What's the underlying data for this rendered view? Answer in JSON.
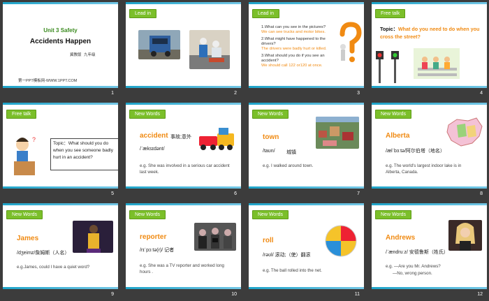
{
  "slides": [
    {
      "num": "1",
      "title_line1": "Unit 3 Safety",
      "title_line2": "Accidents Happen",
      "sub1": "冀教版",
      "sub2": "九年级",
      "footer": "第一PPT模板网-WWW.1PPT.COM"
    },
    {
      "num": "2",
      "tag": "Lead in"
    },
    {
      "num": "3",
      "tag": "Lead in",
      "q1": "1.What can you see in the pictures?",
      "a1": "We can see trucks and motor bikes.",
      "q2": "2.What might have happened to the drivers?",
      "a2": "The drivers were badly hurt or killed.",
      "q3": "3.What should you do if you see an accident?",
      "a3": "We should call 122 or120 at once."
    },
    {
      "num": "4",
      "tag": "Free talk",
      "topic_label": "Topic：",
      "topic": "What do you need to do when you cross the street?"
    },
    {
      "num": "5",
      "tag": "Free talk",
      "topic_label": "Topic：",
      "topic": "What should you do when you see someone badly hurt in an accident?"
    },
    {
      "num": "6",
      "tag": "New Words",
      "word": "accident",
      "meaning": "事故;意外",
      "phon": "/ˈæksɪdənt/",
      "eg": "e.g. She was involved in a serious car accident last week."
    },
    {
      "num": "7",
      "tag": "New Words",
      "word": "town",
      "phon": "/taʊn/",
      "meaning": "城镇",
      "eg": "e.g. I walked around town."
    },
    {
      "num": "8",
      "tag": "New Words",
      "word": "Alberta",
      "phon": "/ælˈbɜːtə/阿尔伯塔（地名）",
      "eg": "e.g. The world's largest indoor lake is in Alberta, Canada."
    },
    {
      "num": "9",
      "tag": "New Words",
      "word": "James",
      "phon": "/dʒeimz/詹姆斯（人名）",
      "eg": "e.g.James, could I have a quiet word?"
    },
    {
      "num": "10",
      "tag": "New Words",
      "word": "reporter",
      "phon": "/rɪˈpɔːtə(r)/ 记者",
      "eg": "e.g. She was a TV reporter and worked long hours ."
    },
    {
      "num": "11",
      "tag": "New Words",
      "word": "roll",
      "phon": "/rəʊl/  滚动;（使）翻滚",
      "eg": "e.g. The ball rolled into the net."
    },
    {
      "num": "12",
      "tag": "New Words",
      "word": "Andrews",
      "phon": "/ˈændruːz/  安德鲁斯（姓氏）",
      "eg1": "e.g.  —Are you Mr. Andrews?",
      "eg2": "—No, wrong person."
    }
  ]
}
